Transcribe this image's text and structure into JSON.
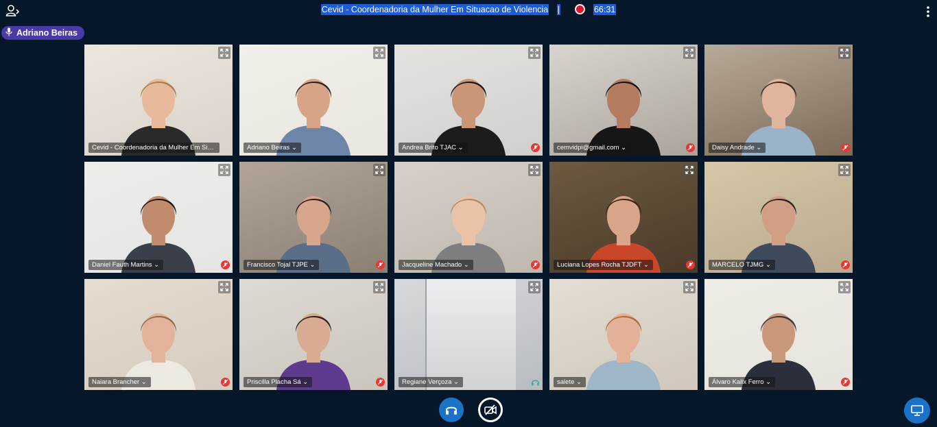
{
  "header": {
    "title": "Cevid - Coordenadoria da Mulher Em Situacao de Violencia",
    "separator": "|",
    "timer": "66:31",
    "users_icon": "users-icon",
    "menu_icon": "more-vertical-icon",
    "recording_icon": "recording-dot-icon"
  },
  "talking_indicator": {
    "name": "Adriano Beiras",
    "icon": "microphone-icon"
  },
  "participants": [
    {
      "name": "Cevid - Coordenadoria da Mulher Em Si... ⌄",
      "status": "none",
      "bg": "#d8d2c8",
      "wall": "#ece6dc",
      "shirt": "#2a2a2a",
      "skin": "#e7b99a",
      "hair": "#a67a4a"
    },
    {
      "name": "Adriano Beiras ⌄",
      "status": "none",
      "bg": "#e9e6df",
      "wall": "#f2efe8",
      "shirt": "#6d86a8",
      "skin": "#d7a487",
      "hair": "#2b211b"
    },
    {
      "name": "Andrea Brito TJAC ⌄",
      "status": "muted",
      "bg": "#cfcfcd",
      "wall": "#e4e3e0",
      "shirt": "#1c1c1c",
      "skin": "#c99677",
      "hair": "#1a1410"
    },
    {
      "name": "cemvidpi@gmail.com ⌄",
      "status": "muted",
      "bg": "#a9a39c",
      "wall": "#d9d4cd",
      "shirt": "#161616",
      "skin": "#b47c5f",
      "hair": "#151010"
    },
    {
      "name": "Daisy Andrade ⌄",
      "status": "muted",
      "bg": "#7d6a58",
      "wall": "#b8aa98",
      "shirt": "#9bb3c9",
      "skin": "#e0b49d",
      "hair": "#3b2a20"
    },
    {
      "name": "Daniel Fauth Martins ⌄",
      "status": "muted",
      "bg": "#e4e4e2",
      "wall": "#ededeb",
      "shirt": "#3b3f4a",
      "skin": "#c18c6e",
      "hair": "#1b1512"
    },
    {
      "name": "Francisco Tojal TJPE ⌄",
      "status": "muted",
      "bg": "#8b7f74",
      "wall": "#b2a598",
      "shirt": "#5b6e88",
      "skin": "#d8a68c",
      "hair": "#2a1f18"
    },
    {
      "name": "Jacqueline Machado ⌄",
      "status": "muted",
      "bg": "#bdb7ae",
      "wall": "#d6d0c6",
      "shirt": "#7e7e80",
      "skin": "#e9c2a7",
      "hair": "#b48a5c"
    },
    {
      "name": "Luciana Lopes Rocha TJDFT ⌄",
      "status": "muted",
      "bg": "#4a3a2a",
      "wall": "#6e5a40",
      "shirt": "#c8462a",
      "skin": "#d9a58a",
      "hair": "#3a2618"
    },
    {
      "name": "MARCELO TJMG ⌄",
      "status": "muted",
      "bg": "#b9a98e",
      "wall": "#d7c7a8",
      "shirt": "#3f4b5c",
      "skin": "#cf9e84",
      "hair": "#2a221c"
    },
    {
      "name": "Naiara Brancher ⌄",
      "status": "muted",
      "bg": "#d6cbbf",
      "wall": "#e6dbcf",
      "shirt": "#ece9e3",
      "skin": "#e2b39a",
      "hair": "#8c6a4a"
    },
    {
      "name": "Priscilla Placha Sá ⌄",
      "status": "muted",
      "bg": "#c9c4bc",
      "wall": "#dedad3",
      "shirt": "#5e3b8f",
      "skin": "#d9ab93",
      "hair": "#2e2018"
    },
    {
      "name": "Regiane Verçoza ⌄",
      "status": "listen",
      "bg": "#b7bcc1",
      "wall": "#d7d9db",
      "shirt": "none",
      "skin": "none",
      "hair": "none"
    },
    {
      "name": "salete ⌄",
      "status": "none",
      "bg": "#cfc7bc",
      "wall": "#e4ddd2",
      "shirt": "#9fb6c8",
      "skin": "#e2b197",
      "hair": "#b06a35"
    },
    {
      "name": "Álvaro Kalix Ferro ⌄",
      "status": "muted",
      "bg": "#e6e3dd",
      "wall": "#efece6",
      "shirt": "#2b2f3a",
      "skin": "#c99779",
      "hair": "#3b3532"
    }
  ],
  "controls": {
    "audio_icon": "headphones-icon",
    "video_icon": "video-off-icon",
    "presentation_icon": "presentation-icon",
    "expand_icon": "fullscreen-icon"
  },
  "colors": {
    "background": "#06172a",
    "accent": "#1a73c9",
    "muted": "#e53935",
    "talking_pill": "#4a3aa8",
    "selection": "#1e5bd6"
  }
}
